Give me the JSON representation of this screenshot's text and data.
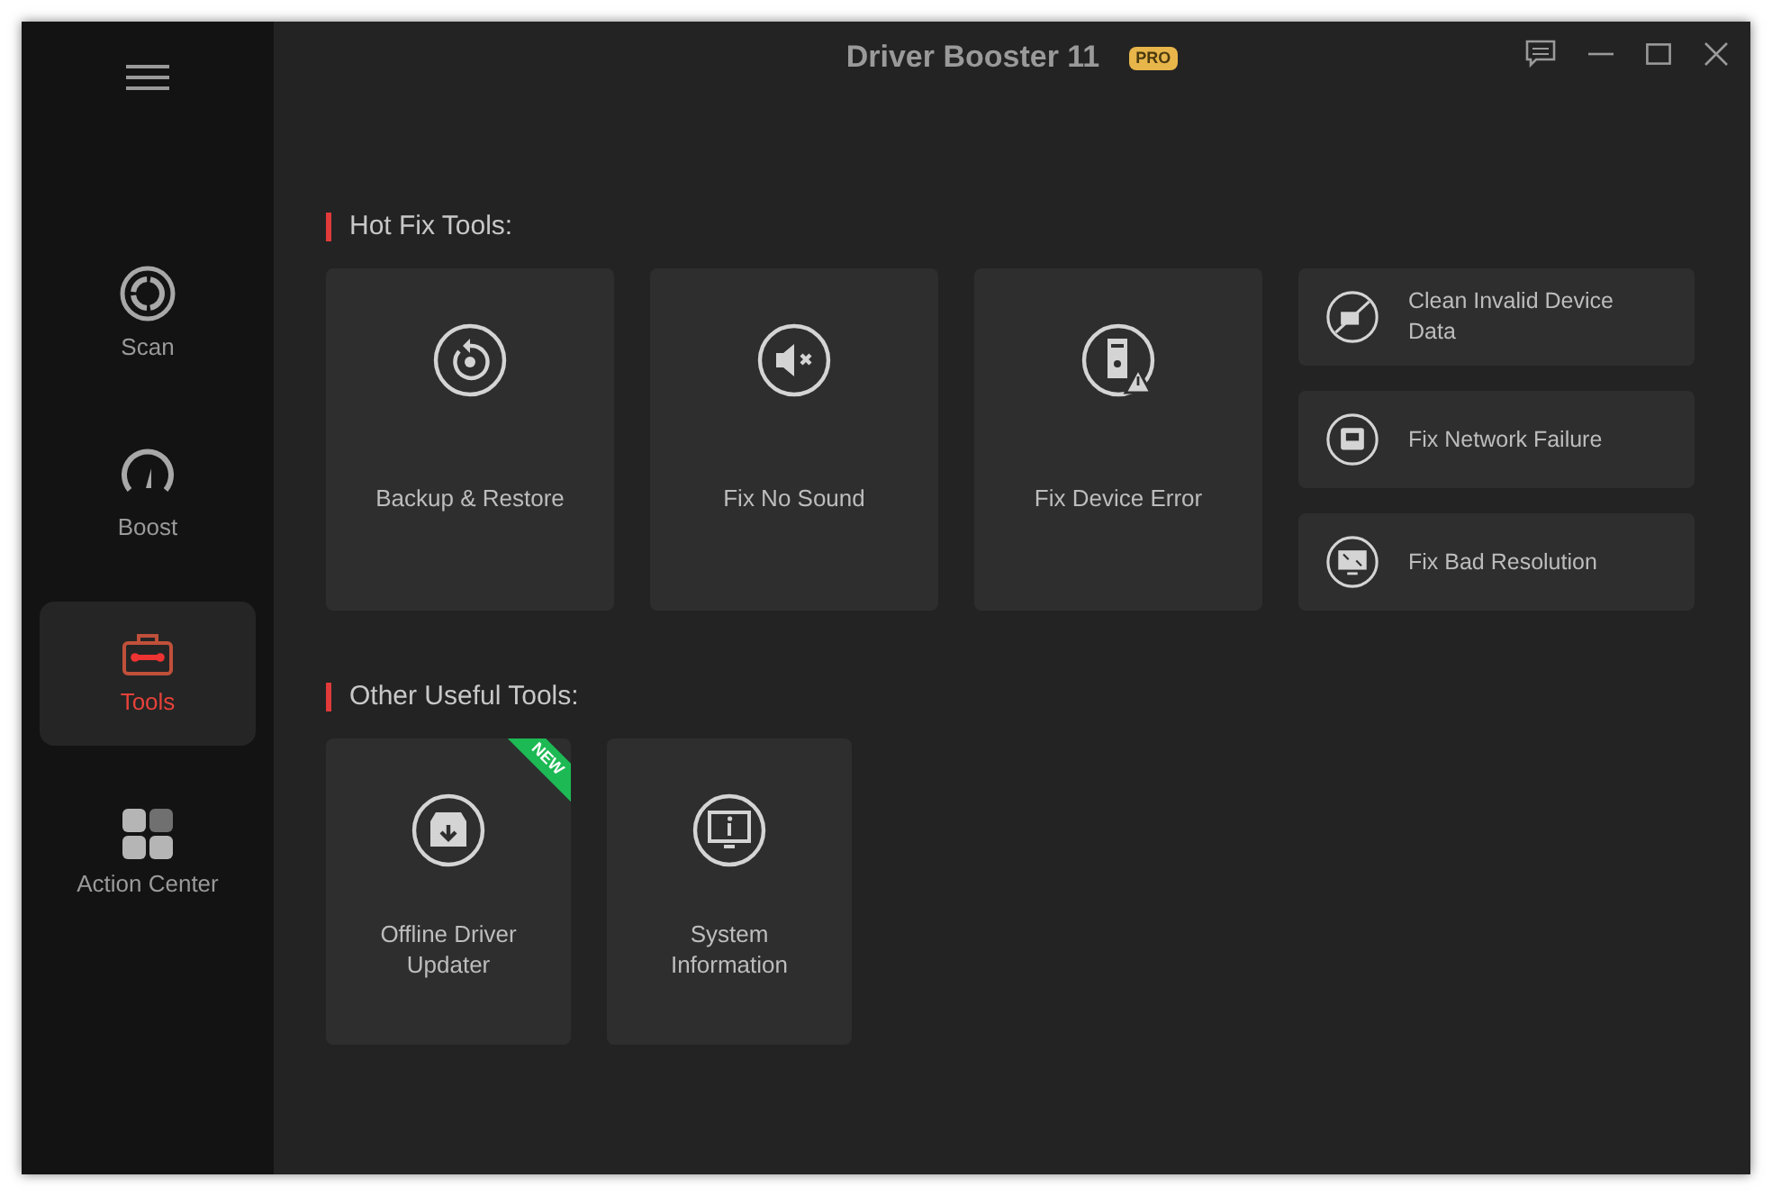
{
  "window": {
    "title": "Driver Booster 11",
    "edition_badge": "PRO"
  },
  "sidebar": {
    "items": [
      {
        "label": "Scan",
        "selected": false
      },
      {
        "label": "Boost",
        "selected": false
      },
      {
        "label": "Tools",
        "selected": true
      },
      {
        "label": "Action Center",
        "selected": false
      }
    ]
  },
  "hot_fix_tools": {
    "heading": "Hot Fix Tools:",
    "large_tiles": [
      {
        "label": "Backup & Restore"
      },
      {
        "label": "Fix No Sound"
      },
      {
        "label": "Fix Device Error"
      }
    ],
    "small_tiles": [
      {
        "label": "Clean Invalid Device Data"
      },
      {
        "label": "Fix Network Failure"
      },
      {
        "label": "Fix Bad Resolution"
      }
    ]
  },
  "other_useful_tools": {
    "heading": "Other Useful Tools:",
    "tiles": [
      {
        "label": "Offline Driver Updater",
        "badge": "NEW"
      },
      {
        "label": "System Information"
      }
    ]
  }
}
